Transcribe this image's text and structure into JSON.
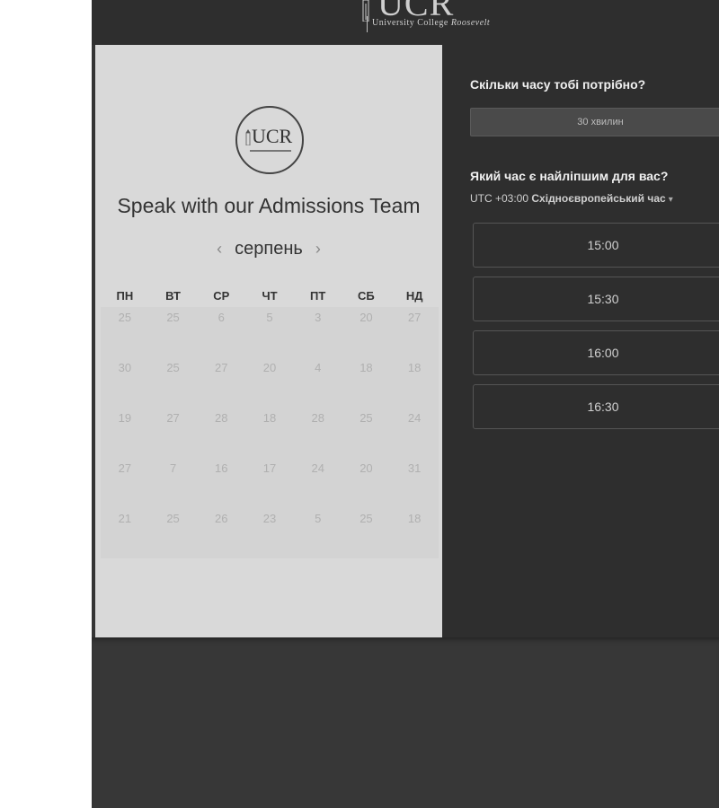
{
  "banner": {
    "logo_text": "UCR",
    "logo_subtitle_prefix": "University College",
    "logo_subtitle_name": "Roosevelt"
  },
  "calendar_panel": {
    "logo_text": "UCR",
    "title": "Speak with our Admissions Team",
    "month": "серпень",
    "prev_icon": "chevron-left-icon",
    "next_icon": "chevron-right-icon",
    "weekdays": [
      "ПН",
      "ВТ",
      "СР",
      "ЧТ",
      "ПТ",
      "СБ",
      "НД"
    ],
    "weeks": [
      [
        "25",
        "25",
        "6",
        "5",
        "3",
        "20",
        "27"
      ],
      [
        "30",
        "25",
        "27",
        "20",
        "4",
        "18",
        "18"
      ],
      [
        "19",
        "27",
        "28",
        "18",
        "28",
        "25",
        "24"
      ],
      [
        "27",
        "7",
        "16",
        "17",
        "24",
        "20",
        "31"
      ],
      [
        "21",
        "25",
        "26",
        "23",
        "5",
        "25",
        "18"
      ]
    ]
  },
  "booking_panel": {
    "duration_question": "Скільки часу тобі потрібно?",
    "duration_option": "30 хвилин",
    "time_question": "Який час є найліпшим для вас?",
    "timezone_offset": "UTC +03:00",
    "timezone_name": "Східноєвропейський час",
    "timezone_caret": "▾",
    "slots": [
      "15:00",
      "15:30",
      "16:00",
      "16:30"
    ]
  },
  "colors": {
    "page_bg": "#343434",
    "left_panel_bg": "#d9d9d9",
    "right_panel_bg": "#2e2e2e"
  }
}
